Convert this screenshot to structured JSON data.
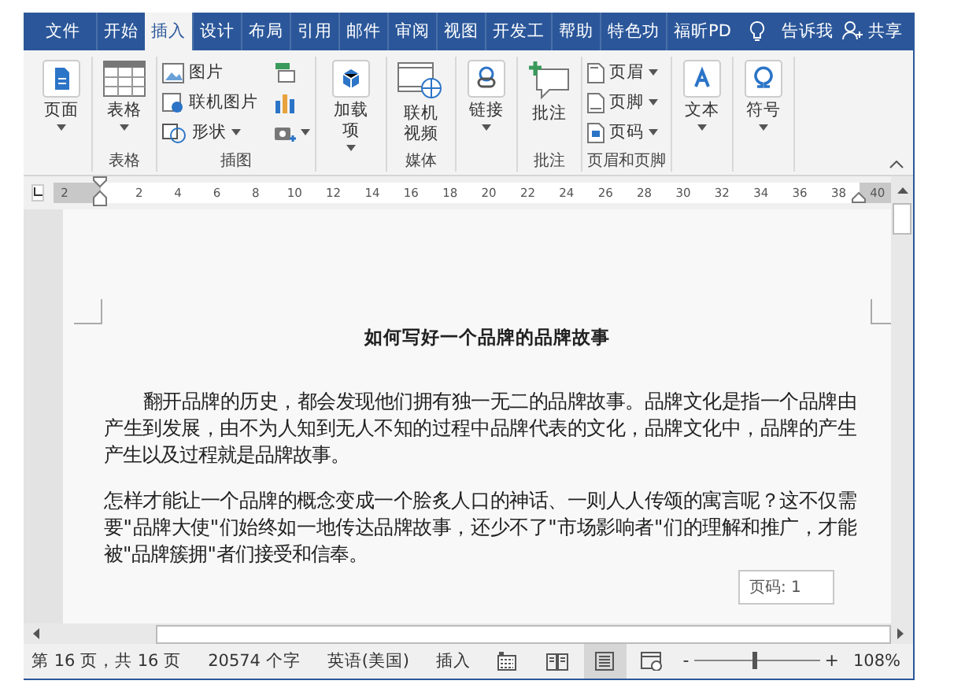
{
  "tabs": [
    {
      "label": "文件",
      "selected": false
    },
    {
      "label": "开始",
      "selected": false
    },
    {
      "label": "插入",
      "selected": true
    },
    {
      "label": "设计",
      "selected": false
    },
    {
      "label": "布局",
      "selected": false
    },
    {
      "label": "引用",
      "selected": false
    },
    {
      "label": "邮件",
      "selected": false
    },
    {
      "label": "审阅",
      "selected": false
    },
    {
      "label": "视图",
      "selected": false
    },
    {
      "label": "开发工",
      "selected": false
    },
    {
      "label": "帮助",
      "selected": false
    },
    {
      "label": "特色功",
      "selected": false
    },
    {
      "label": "福昕PD",
      "selected": false
    }
  ],
  "tell_me": "告诉我",
  "share": "共享",
  "ribbon": {
    "groups": [
      {
        "items": [
          {
            "kind": "large",
            "label": "页面",
            "dropdown": true
          }
        ]
      },
      {
        "caption": "表格",
        "items": [
          {
            "kind": "large",
            "label": "表格",
            "dropdown": true
          }
        ]
      },
      {
        "caption": "插图",
        "items": [
          {
            "kind": "small",
            "label": "图片",
            "dropdown": false
          },
          {
            "kind": "small",
            "label": "联机图片",
            "dropdown": false
          },
          {
            "kind": "small",
            "label": "形状",
            "dropdown": true
          },
          {
            "kind": "icon",
            "dropdown": false
          },
          {
            "kind": "icon",
            "dropdown": false
          },
          {
            "kind": "icon",
            "dropdown": true
          }
        ]
      },
      {
        "items": [
          {
            "kind": "large",
            "label": "加载项",
            "dropdown": true
          }
        ]
      },
      {
        "caption": "媒体",
        "items": [
          {
            "kind": "large",
            "label": "联机视频",
            "dropdown": false
          }
        ]
      },
      {
        "items": [
          {
            "kind": "large",
            "label": "链接",
            "dropdown": true
          }
        ]
      },
      {
        "caption": "批注",
        "items": [
          {
            "kind": "large",
            "label": "批注",
            "dropdown": false
          }
        ]
      },
      {
        "caption": "页眉和页脚",
        "items": [
          {
            "kind": "small",
            "label": "页眉",
            "dropdown": true
          },
          {
            "kind": "small",
            "label": "页脚",
            "dropdown": true
          },
          {
            "kind": "small",
            "label": "页码",
            "dropdown": true
          }
        ]
      },
      {
        "items": [
          {
            "kind": "large",
            "label": "文本",
            "dropdown": true
          }
        ]
      },
      {
        "items": [
          {
            "kind": "large",
            "label": "符号",
            "dropdown": true
          }
        ]
      }
    ]
  },
  "ruler": {
    "labels": [
      "2",
      "2",
      "4",
      "6",
      "8",
      "10",
      "12",
      "14",
      "16",
      "18",
      "20",
      "22",
      "24",
      "26",
      "28",
      "30",
      "32",
      "34",
      "36",
      "38",
      "40"
    ]
  },
  "document": {
    "title": "如何写好一个品牌的品牌故事",
    "paragraphs": [
      {
        "text": "翻开品牌的历史，都会发现他们拥有独一无二的品牌故事。品牌文化是指一个品牌由产生到发展，由不为人知到无人不知的过程中品牌代表的文化，品牌文化中，品牌的产生产生以及过程就是品牌故事。",
        "first_line_indent": true
      },
      {
        "text": "怎样才能让一个品牌的概念变成一个脍炙人口的神话、一则人人传颂的寓言呢？这不仅需要\"品牌大使\"们始终如一地传达品牌故事，还少不了\"市场影响者\"们的理解和推广，才能被\"品牌簇拥\"者们接受和信奉。",
        "first_line_indent": false
      }
    ]
  },
  "tooltip": "页码: 1",
  "status_bar": {
    "page": "第 16 页，共 16 页",
    "words": "20574 个字",
    "language": "英语(美国)",
    "mode": "插入",
    "views": [
      {
        "selected": false
      },
      {
        "selected": true
      },
      {
        "selected": false
      }
    ],
    "zoom_out": "-",
    "zoom_in": "+",
    "zoom": {
      "level": 0.48
    },
    "zoom_text": "108%"
  }
}
